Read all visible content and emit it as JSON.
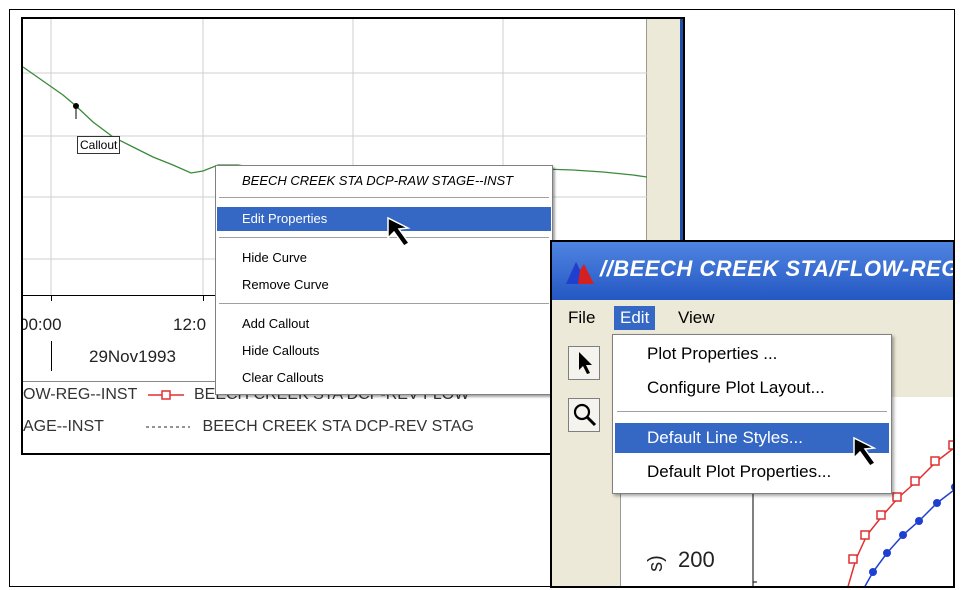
{
  "plot": {
    "callout_label": "Callout",
    "x_ticks": [
      "00:00",
      "12:0"
    ],
    "date_label": "29Nov1993",
    "legend": [
      {
        "left_text": "OW-REG--INST",
        "right_text": "BEECH CREEK STA DCP-REV FLOW"
      },
      {
        "left_text": "AGE--INST",
        "right_text": "BEECH CREEK STA DCP-REV STAG"
      }
    ],
    "curve_color": "#3a8a3a"
  },
  "context_menu": {
    "title": "BEECH CREEK STA DCP-RAW STAGE--INST",
    "items": {
      "edit_properties": "Edit Properties",
      "hide_curve": "Hide Curve",
      "remove_curve": "Remove Curve",
      "add_callout": "Add Callout",
      "hide_callouts": "Hide Callouts",
      "clear_callouts": "Clear Callouts"
    },
    "selected": "Edit Properties"
  },
  "window": {
    "title": "//BEECH CREEK STA/FLOW-REG--",
    "menubar": [
      "File",
      "Edit",
      "View"
    ],
    "active_menu": "Edit",
    "y_tick": "200",
    "y_axis_fragment": "s)"
  },
  "edit_menu": {
    "items": {
      "plot_properties": "Plot Properties ...",
      "configure_layout": "Configure Plot Layout...",
      "default_line_styles": "Default Line Styles...",
      "default_plot_properties": "Default Plot Properties..."
    },
    "selected": "Default Line Styles..."
  },
  "colors": {
    "selection": "#3568c4",
    "series_red": "#e03030",
    "series_blue": "#1f3fd0"
  }
}
